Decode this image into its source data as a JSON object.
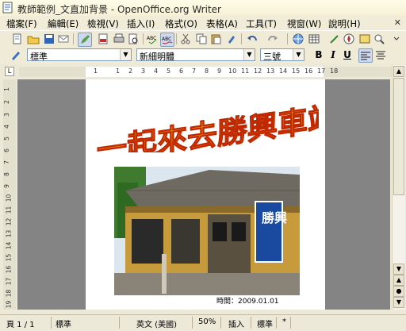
{
  "window": {
    "title": "教師範例_文直加背景 - OpenOffice.org Writer",
    "close_glyph": "✕"
  },
  "menu": [
    "檔案(F)",
    "編輯(E)",
    "檢視(V)",
    "插入(I)",
    "格式(O)",
    "表格(A)",
    "工具(T)",
    "視窗(W)",
    "說明(H)"
  ],
  "format_bar": {
    "style": "標準",
    "font": "新細明體",
    "size": "三號",
    "bold": "B",
    "italic": "I",
    "underline": "U"
  },
  "ruler": {
    "h_ticks": [
      "1",
      "1",
      "2",
      "3",
      "4",
      "5",
      "6",
      "7",
      "8",
      "9",
      "10",
      "11",
      "12",
      "13",
      "14",
      "15",
      "16",
      "17",
      "18"
    ],
    "v_ticks": [
      "1",
      "2",
      "3",
      "4",
      "5",
      "6",
      "7",
      "8",
      "9",
      "10",
      "11",
      "12",
      "13",
      "14",
      "15",
      "16",
      "17",
      "18",
      "19"
    ]
  },
  "document": {
    "heading_art": "一起來去勝興車站",
    "sign_text": "勝興",
    "caption": "時間：2009.01.01"
  },
  "status": {
    "page": "頁 1 / 1",
    "style": "標準",
    "language": "英文 (美國)",
    "zoom": "50%",
    "insert_mode": "插入",
    "selection_mode": "標準",
    "extra": "*"
  }
}
